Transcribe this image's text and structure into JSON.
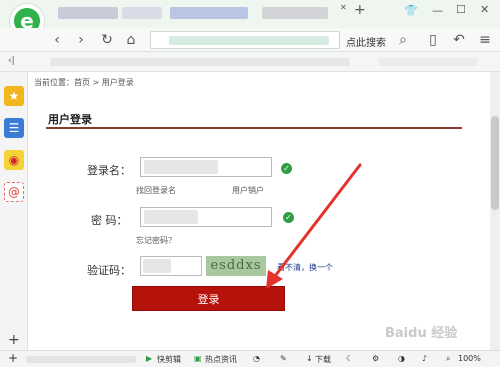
{
  "browser": {
    "logo_letter": "e",
    "search_label": "点此搜索",
    "add_tab": "+",
    "add_sidebar": "+"
  },
  "breadcrumb": "当前位置：首页 > 用户登录",
  "section": {
    "title": "用户登录"
  },
  "form": {
    "username_label": "登录名：",
    "password_label": "密  码：",
    "captcha_label": "验证码：",
    "recover_username": "找回登录名",
    "user_unlock": "用户销户",
    "forgot_password": "忘记密码？",
    "captcha_text": "esddxs",
    "refresh_captcha": "看不清，换一个",
    "login_button": "登录"
  },
  "statusbar": {
    "quick_clip": "快剪辑",
    "hot_news": "热点资讯",
    "download": "下载",
    "zoom": "100%"
  },
  "watermark": "Baidu 经验",
  "colors": {
    "accent": "#b5120b",
    "valid": "#2e9e43",
    "rule": "#8b3a2b",
    "link": "#1b3a8a"
  }
}
